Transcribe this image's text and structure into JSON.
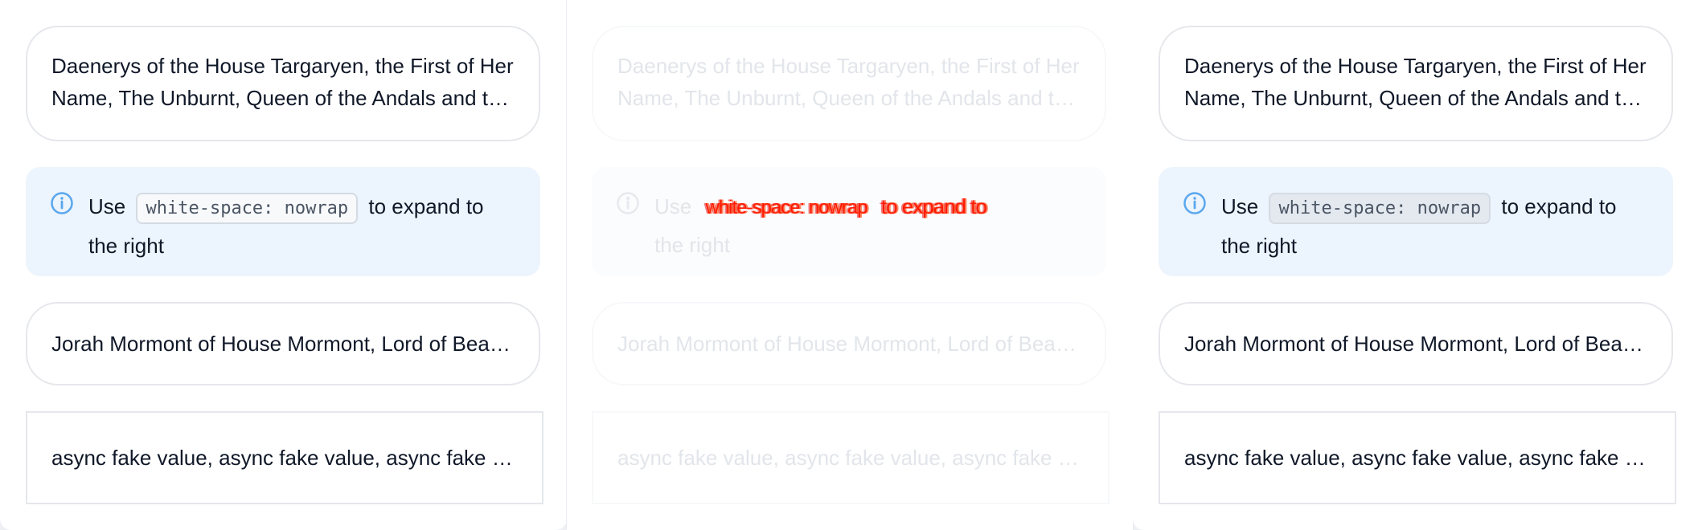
{
  "colors": {
    "text": "#101828",
    "info_bg": "#ecf4fd",
    "info_icon": "#5aa7ee",
    "border": "#e5e7eb",
    "glitch_red": "#ff1a00"
  },
  "panels": [
    {
      "multiline_text": "Daenerys of the House Targaryen, the First of Her Name, The Unburnt, Queen of the Andals and the First Men, Khaleesi of the Great Grass Sea",
      "info": {
        "icon": "info-circle-icon",
        "use_label": "Use",
        "code": "white-space: nowrap",
        "suffix": "to expand to the right"
      },
      "single_text": "Jorah Mormont of House Mormont, Lord of Bear Island",
      "async_text": "async fake value, async fake value, async fake value, async fake value"
    },
    {
      "multiline_text": "Daenerys of the House Targaryen, the First of Her Name, The Unburnt, Queen of the Andals and the First Men, Khaleesi of the Great Grass Sea",
      "info": {
        "icon": "info-circle-icon",
        "use_label": "Use",
        "code": "white-space: nowrap",
        "suffix_inline": "to expand to",
        "suffix_rest": "the right"
      },
      "single_text": "Jorah Mormont of House Mormont, Lord of Bear Island",
      "async_text": "async fake value, async fake value, async fake value, async fake value"
    },
    {
      "multiline_text": "Daenerys of the House Targaryen, the First of Her Name, The Unburnt, Queen of the Andals and the First Men, Khaleesi of the Great Grass Sea",
      "info": {
        "icon": "info-circle-icon",
        "use_label": "Use",
        "code": "white-space: nowrap",
        "suffix": "to expand to the right"
      },
      "single_text": "Jorah Mormont of House Mormont, Lord of Bear Island",
      "async_text": "async fake value, async fake value, async fake value, async fake value"
    }
  ]
}
